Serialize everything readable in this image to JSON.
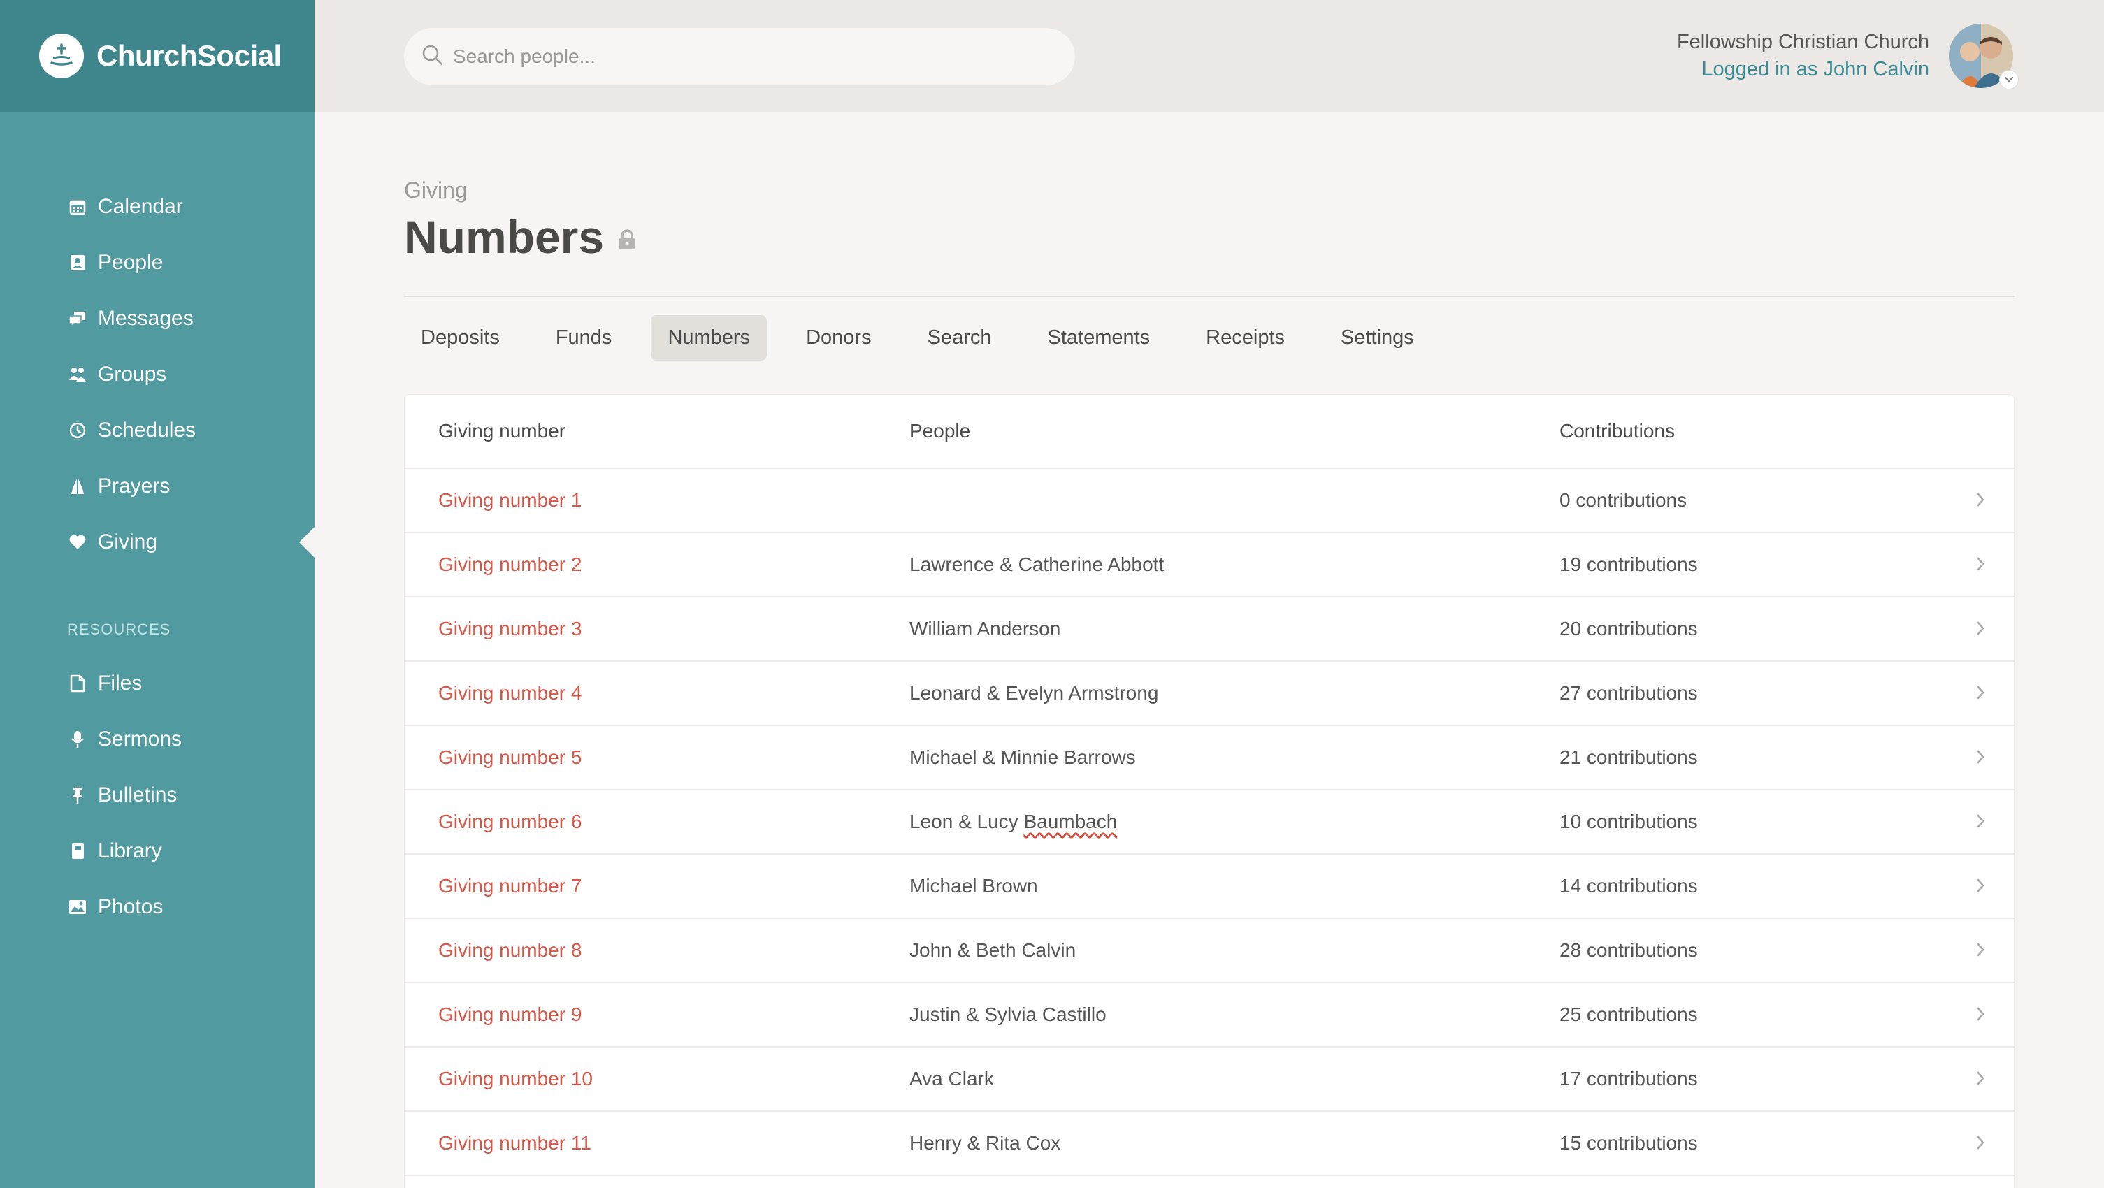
{
  "brand": {
    "name": "ChurchSocial"
  },
  "sidebar": {
    "items": [
      {
        "label": "Calendar",
        "icon": "calendar-icon"
      },
      {
        "label": "People",
        "icon": "people-icon"
      },
      {
        "label": "Messages",
        "icon": "messages-icon"
      },
      {
        "label": "Groups",
        "icon": "groups-icon"
      },
      {
        "label": "Schedules",
        "icon": "clock-icon"
      },
      {
        "label": "Prayers",
        "icon": "praying-hands-icon"
      },
      {
        "label": "Giving",
        "icon": "heart-icon",
        "active": true
      }
    ],
    "resources_label": "RESOURCES",
    "resources": [
      {
        "label": "Files",
        "icon": "file-icon"
      },
      {
        "label": "Sermons",
        "icon": "microphone-icon"
      },
      {
        "label": "Bulletins",
        "icon": "pin-icon"
      },
      {
        "label": "Library",
        "icon": "book-icon"
      },
      {
        "label": "Photos",
        "icon": "photo-icon"
      }
    ]
  },
  "topbar": {
    "search_placeholder": "Search people...",
    "church_name": "Fellowship Christian Church",
    "logged_in": "Logged in as John Calvin"
  },
  "page": {
    "eyebrow": "Giving",
    "title": "Numbers"
  },
  "tabs": [
    "Deposits",
    "Funds",
    "Numbers",
    "Donors",
    "Search",
    "Statements",
    "Receipts",
    "Settings"
  ],
  "active_tab": "Numbers",
  "table": {
    "headers": [
      "Giving number",
      "People",
      "Contributions"
    ],
    "rows": [
      {
        "number": "Giving number 1",
        "people": "",
        "contributions": "0 contributions"
      },
      {
        "number": "Giving number 2",
        "people": "Lawrence & Catherine Abbott",
        "contributions": "19 contributions"
      },
      {
        "number": "Giving number 3",
        "people": "William Anderson",
        "contributions": "20 contributions"
      },
      {
        "number": "Giving number 4",
        "people": "Leonard & Evelyn Armstrong",
        "contributions": "27 contributions"
      },
      {
        "number": "Giving number 5",
        "people": "Michael & Minnie Barrows",
        "contributions": "21 contributions"
      },
      {
        "number": "Giving number 6",
        "people_prefix": "Leon & Lucy ",
        "people_flagged": "Baumbach",
        "contributions": "10 contributions"
      },
      {
        "number": "Giving number 7",
        "people": "Michael Brown",
        "contributions": "14 contributions"
      },
      {
        "number": "Giving number 8",
        "people": "John & Beth Calvin",
        "contributions": "28 contributions"
      },
      {
        "number": "Giving number 9",
        "people": "Justin & Sylvia Castillo",
        "contributions": "25 contributions"
      },
      {
        "number": "Giving number 10",
        "people": "Ava Clark",
        "contributions": "17 contributions"
      },
      {
        "number": "Giving number 11",
        "people": "Henry & Rita Cox",
        "contributions": "15 contributions"
      }
    ]
  },
  "colors": {
    "sidebar": "#509aa0",
    "brand_bar": "#3f868c",
    "link": "#d65747",
    "logged_in": "#3b8b95"
  }
}
